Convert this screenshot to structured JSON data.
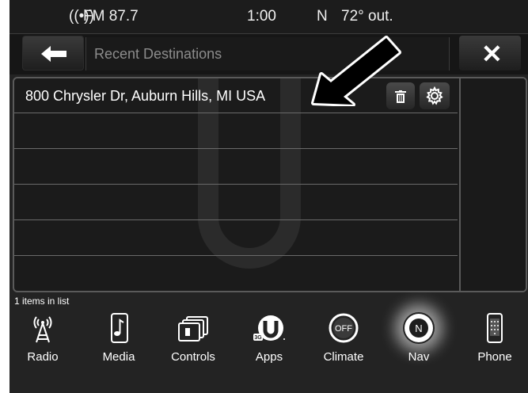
{
  "status": {
    "radio_icon": "((•))",
    "radio_station": "FM 87.7",
    "clock": "1:00",
    "compass": "N",
    "temperature": "72° out."
  },
  "title_bar": {
    "back_icon": "arrow-left-icon",
    "title": "Recent Destinations",
    "close_label": "✕"
  },
  "list": {
    "rows": [
      {
        "text": "800 Chrysler Dr, Auburn Hills, MI USA"
      },
      {
        "text": ""
      },
      {
        "text": ""
      },
      {
        "text": ""
      },
      {
        "text": ""
      },
      {
        "text": ""
      }
    ],
    "count_text": "1 items in list"
  },
  "nav": {
    "items": [
      {
        "label": "Radio",
        "icon": "radio-tower-icon"
      },
      {
        "label": "Media",
        "icon": "music-note-icon"
      },
      {
        "label": "Controls",
        "icon": "controls-icon"
      },
      {
        "label": "Apps",
        "icon": "apps-icon",
        "badge": "3G"
      },
      {
        "label": "Climate",
        "icon": "climate-off-icon",
        "icon_text": "OFF"
      },
      {
        "label": "Nav",
        "icon": "compass-icon",
        "icon_text": "N"
      },
      {
        "label": "Phone",
        "icon": "phone-icon"
      }
    ]
  },
  "colors": {
    "background": "#232323",
    "panel_border": "#5a5a5a",
    "text": "#ffffff",
    "title_text": "#8c8c8c"
  }
}
